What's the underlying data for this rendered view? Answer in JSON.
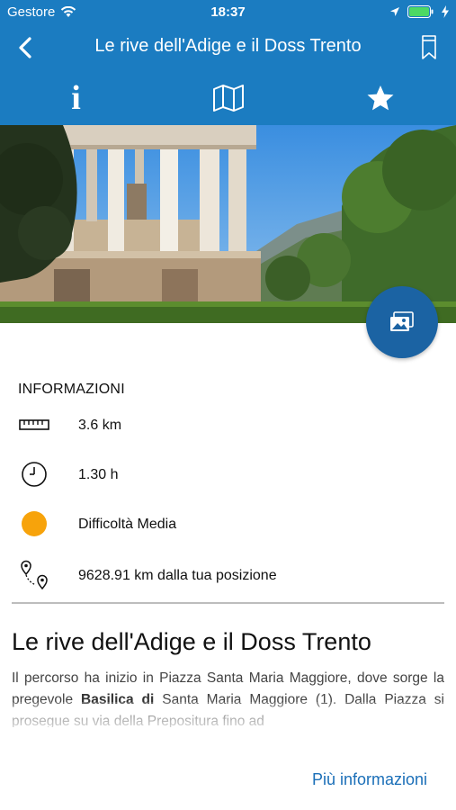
{
  "status": {
    "carrier": "Gestore",
    "time": "18:37"
  },
  "nav": {
    "title": "Le rive dell'Adige e il Doss Trento"
  },
  "tabs": [
    {
      "glyph": "i",
      "icon": "info-icon"
    },
    {
      "icon": "map-icon"
    },
    {
      "icon": "star-icon"
    }
  ],
  "info": {
    "heading": "INFORMAZIONI",
    "distance": "3.6 km",
    "duration": "1.30 h",
    "difficulty": "Difficoltà Media",
    "position": "9628.91 km dalla tua posizione",
    "difficulty_color": "#f7a30b"
  },
  "article": {
    "title": "Le rive dell'Adige e il Doss Trento",
    "p1_a": "Il percorso ha inizio in Piazza Santa Maria Maggiore, dove sorge la pregevole ",
    "p1_bold": "Basilica di",
    "p1_b": " Santa Maria Maggiore (1).",
    "p2": "Dalla Piazza si prosegue su via della Prepositura fino ad",
    "more_link": "Più informazioni"
  },
  "colors": {
    "primary": "#1b7cc1",
    "fab": "#1b63a3",
    "link": "#1b6fb8"
  }
}
